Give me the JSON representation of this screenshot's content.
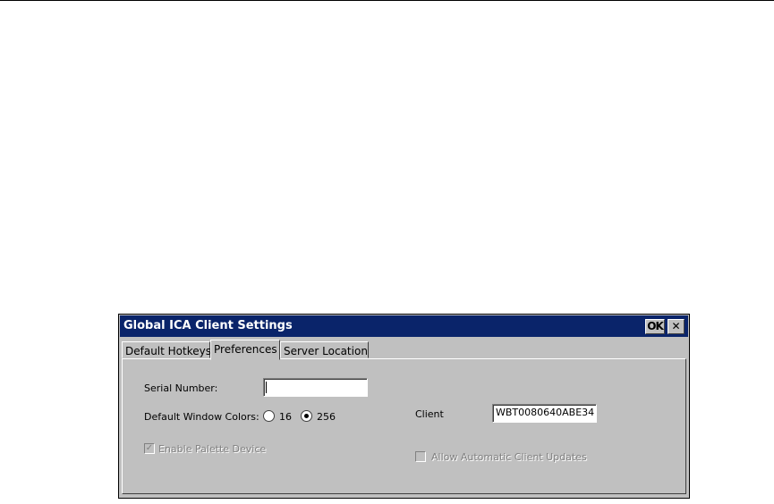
{
  "window": {
    "title": "Global ICA Client Settings",
    "ok_label": "OK",
    "close_label": "✕"
  },
  "tabs": [
    {
      "label": "Default Hotkeys",
      "selected": false
    },
    {
      "label": "Preferences",
      "selected": true
    },
    {
      "label": "Server Location",
      "selected": false
    }
  ],
  "preferences": {
    "serial_number_label": "Serial Number:",
    "serial_number_value": "",
    "colors_label": "Default Window Colors:",
    "color_options": [
      {
        "label": "16",
        "selected": false
      },
      {
        "label": "256",
        "selected": true
      }
    ],
    "palette_label": "Enable Palette Device",
    "palette_checked": true,
    "palette_enabled": false,
    "client_label": "Client",
    "client_value": "WBT0080640ABE34",
    "auto_update_label": "Allow Automatic Client Updates",
    "auto_update_checked": false,
    "auto_update_enabled": false
  }
}
